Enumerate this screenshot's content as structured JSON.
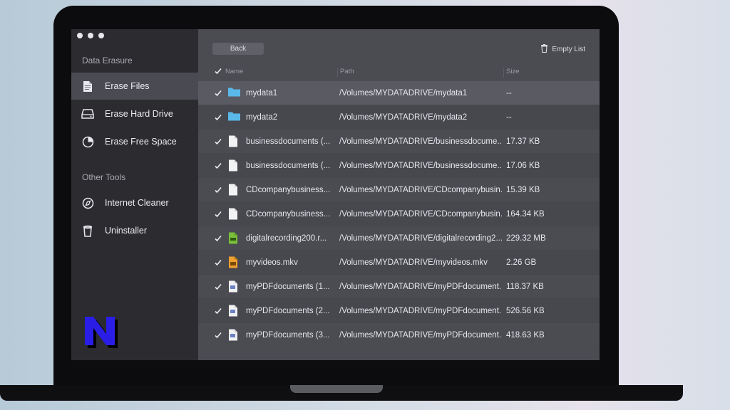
{
  "sidebar": {
    "section1": "Data Erasure",
    "items": [
      {
        "label": "Erase Files",
        "icon": "document-icon",
        "active": true
      },
      {
        "label": "Erase Hard Drive",
        "icon": "hard-drive-icon",
        "active": false
      },
      {
        "label": "Erase Free Space",
        "icon": "pie-chart-icon",
        "active": false
      }
    ],
    "section2": "Other Tools",
    "tools": [
      {
        "label": "Internet Cleaner",
        "icon": "compass-icon"
      },
      {
        "label": "Uninstaller",
        "icon": "trash-can-icon"
      }
    ]
  },
  "toolbar": {
    "back_label": "Back",
    "empty_list_label": "Empty List"
  },
  "table": {
    "columns": [
      "Name",
      "Path",
      "Size"
    ],
    "rows": [
      {
        "name": "mydata1",
        "path": "/Volumes/MYDATADRIVE/mydata1",
        "size": "--",
        "type": "folder",
        "checked": true
      },
      {
        "name": "mydata2",
        "path": "/Volumes/MYDATADRIVE/mydata2",
        "size": "--",
        "type": "folder",
        "checked": true
      },
      {
        "name": "businessdocuments (...",
        "path": "/Volumes/MYDATADRIVE/businessdocume...",
        "size": "17.37 KB",
        "type": "document",
        "checked": true
      },
      {
        "name": "businessdocuments (...",
        "path": "/Volumes/MYDATADRIVE/businessdocume...",
        "size": "17.06 KB",
        "type": "document",
        "checked": true
      },
      {
        "name": "CDcompanybusiness...",
        "path": "/Volumes/MYDATADRIVE/CDcompanybusin...",
        "size": "15.39 KB",
        "type": "document",
        "checked": true
      },
      {
        "name": "CDcompanybusiness...",
        "path": "/Volumes/MYDATADRIVE/CDcompanybusin...",
        "size": "164.34 KB",
        "type": "document",
        "checked": true
      },
      {
        "name": "digitalrecording200.r...",
        "path": "/Volumes/MYDATADRIVE/digitalrecording2...",
        "size": "229.32 MB",
        "type": "audio",
        "checked": true
      },
      {
        "name": "myvideos.mkv",
        "path": "/Volumes/MYDATADRIVE/myvideos.mkv",
        "size": "2.26 GB",
        "type": "video",
        "checked": true
      },
      {
        "name": "myPDFdocuments (1...",
        "path": "/Volumes/MYDATADRIVE/myPDFdocument...",
        "size": "118.37 KB",
        "type": "pdf",
        "checked": true
      },
      {
        "name": "myPDFdocuments (2...",
        "path": "/Volumes/MYDATADRIVE/myPDFdocument...",
        "size": "526.56 KB",
        "type": "pdf",
        "checked": true
      },
      {
        "name": "myPDFdocuments (3...",
        "path": "/Volumes/MYDATADRIVE/myPDFdocument...",
        "size": "418.63 KB",
        "type": "pdf",
        "checked": true
      }
    ]
  },
  "colors": {
    "folder": "#5ab8e8",
    "audio": "#7bbf3a",
    "video": "#f0a030",
    "logo": "#2a1ee6"
  }
}
